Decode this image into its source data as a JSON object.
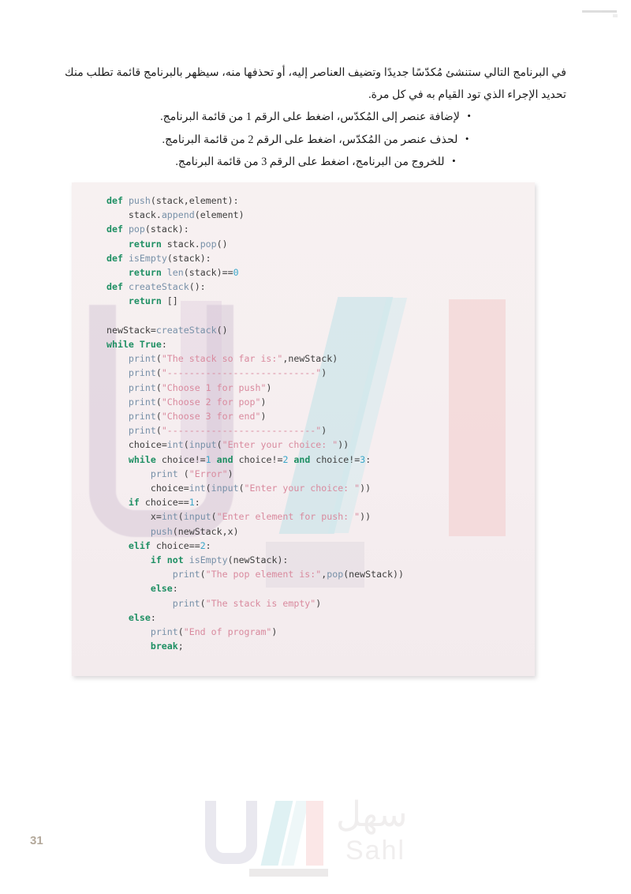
{
  "page": {
    "number": "31",
    "corner_mark": "rule-mark"
  },
  "intro": {
    "paragraph": "في البرنامج التالي ستنشئ مُكدّسًا جديدًا وتضيف العناصر إليه، أو تحذفها منه، سيظهر بالبرنامج قائمة تطلب منك تحديد الإجراء الذي تود القيام به في كل مرة."
  },
  "bullets": [
    {
      "text": "لإضافة عنصر إلى المُكدّس، اضغط على الرقم 1 من قائمة البرنامج."
    },
    {
      "text": "لحذف عنصر من المُكدّس، اضغط على الرقم 2 من قائمة البرنامج."
    },
    {
      "text": "للخروج من البرنامج، اضغط على الرقم 3 من قائمة البرنامج."
    }
  ],
  "code": {
    "language": "python",
    "lines": [
      "def push(stack,element):",
      "    stack.append(element)",
      "def pop(stack):",
      "    return stack.pop()",
      "def isEmpty(stack):",
      "    return len(stack)==0",
      "def createStack():",
      "    return []",
      "",
      "newStack=createStack()",
      "while True:",
      "    print(\"The stack so far is:\",newStack)",
      "    print(\"---------------------------\")",
      "    print(\"Choose 1 for push\")",
      "    print(\"Choose 2 for pop\")",
      "    print(\"Choose 3 for end\")",
      "    print(\"---------------------------\")",
      "    choice=int(input(\"Enter your choice: \"))",
      "    while choice!=1 and choice!=2 and choice!=3:",
      "        print (\"Error\")",
      "        choice=int(input(\"Enter your choice: \"))",
      "    if choice==1:",
      "        x=int(input(\"Enter element for push: \"))",
      "        push(newStack,x)",
      "    elif choice==2:",
      "        if not isEmpty(newStack):",
      "            print(\"The pop element is:\",pop(newStack))",
      "        else:",
      "            print(\"The stack is empty\")",
      "    else:",
      "        print(\"End of program\")",
      "        break;"
    ]
  },
  "footer": {
    "brand_arabic": "سهل",
    "brand_latin": "Sahl"
  },
  "colors": {
    "code_background": "#f6eff0",
    "keyword": "#1e8f63",
    "function": "#7790a8",
    "string": "#d98a9e",
    "number": "#3aa6c9",
    "page_number": "#b3a89a"
  }
}
